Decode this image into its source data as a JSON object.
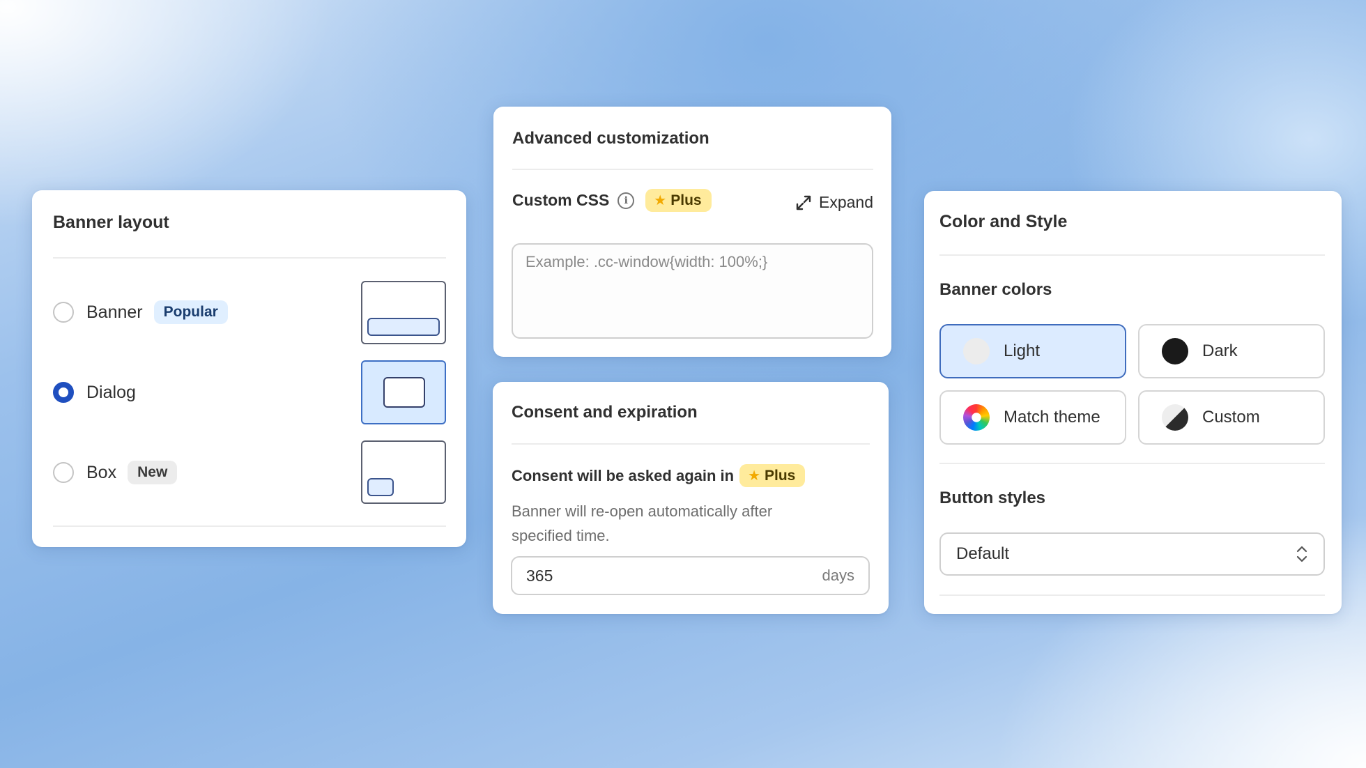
{
  "banner_layout": {
    "title": "Banner layout",
    "options": [
      {
        "label": "Banner",
        "tag": "Popular",
        "selected": false
      },
      {
        "label": "Dialog",
        "tag": "",
        "selected": true
      },
      {
        "label": "Box",
        "tag": "New",
        "selected": false
      }
    ]
  },
  "advanced": {
    "title": "Advanced customization",
    "custom_css_label": "Custom CSS",
    "plus_label": "Plus",
    "expand_label": "Expand",
    "css_placeholder": "Example: .cc-window{width: 100%;}"
  },
  "consent": {
    "title": "Consent and expiration",
    "asked_again_label": "Consent will be asked again in",
    "plus_label": "Plus",
    "help_text": "Banner will re-open automatically after specified time.",
    "days_value": "365",
    "days_suffix": "days"
  },
  "color_style": {
    "title": "Color and Style",
    "banner_colors_label": "Banner colors",
    "colors": [
      {
        "label": "Light",
        "icon": "light-swatch-icon",
        "selected": true
      },
      {
        "label": "Dark",
        "icon": "dark-swatch-icon",
        "selected": false
      },
      {
        "label": "Match theme",
        "icon": "color-wheel-icon",
        "selected": false
      },
      {
        "label": "Custom",
        "icon": "custom-swatch-icon",
        "selected": false
      }
    ],
    "button_styles_label": "Button styles",
    "button_style_value": "Default"
  },
  "colors": {
    "accent": "#1f4fbf",
    "selected_bg": "#dcebff",
    "plus_badge": "#ffeb9c",
    "star": "#f2a900",
    "dark_swatch": "#1a1a1a",
    "light_swatch": "#ececec"
  }
}
